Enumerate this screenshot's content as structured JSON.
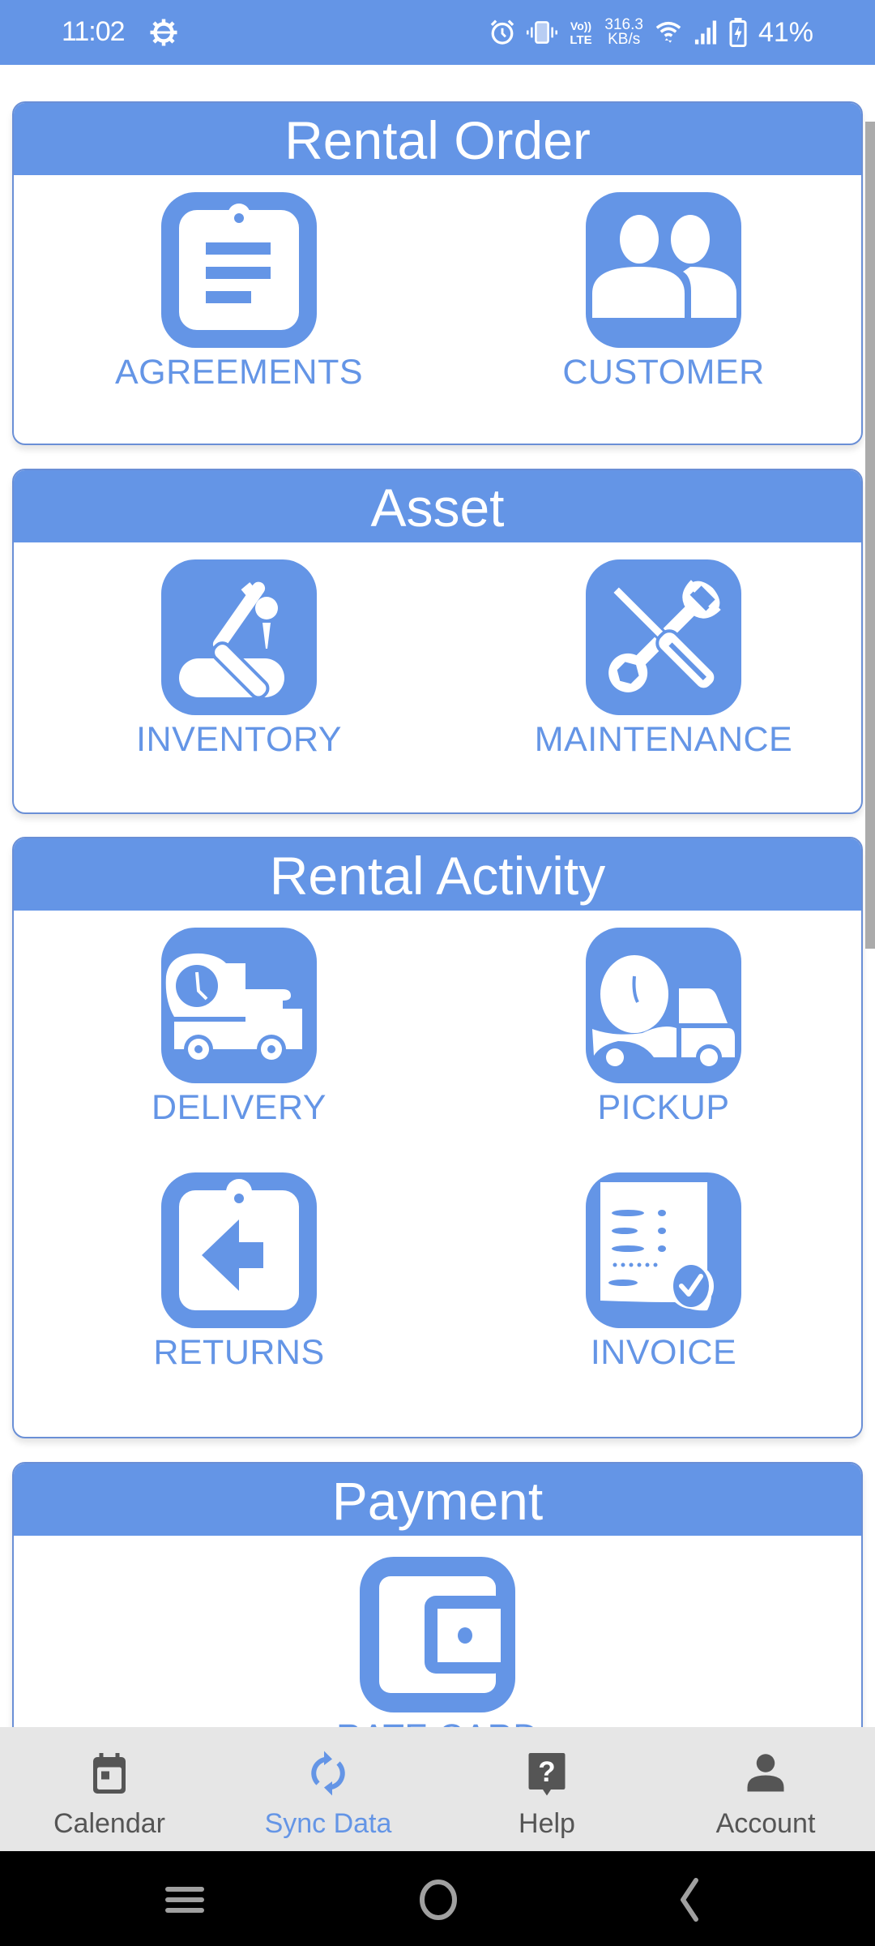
{
  "status_bar": {
    "time": "11:02",
    "net_speed_value": "316.3",
    "net_speed_unit": "KB/s",
    "volte_label_top": "Vo))",
    "volte_label_bottom": "LTE",
    "battery_percent": "41%",
    "icons": [
      "settings-gear-icon",
      "alarm-icon",
      "vibrate-icon",
      "volte-icon",
      "wifi-icon",
      "signal-icon",
      "battery-charging-icon"
    ]
  },
  "sections": [
    {
      "title": "Rental Order",
      "items": [
        {
          "label": "AGREEMENTS",
          "icon": "clipboard-list-icon"
        },
        {
          "label": "CUSTOMER",
          "icon": "people-icon"
        }
      ]
    },
    {
      "title": "Asset",
      "items": [
        {
          "label": "INVENTORY",
          "icon": "robot-arm-icon"
        },
        {
          "label": "MAINTENANCE",
          "icon": "wrench-screwdriver-icon"
        }
      ]
    },
    {
      "title": "Rental Activity",
      "items": [
        {
          "label": "DELIVERY",
          "icon": "delivery-truck-clock-icon"
        },
        {
          "label": "PICKUP",
          "icon": "pickup-truck-clock-icon"
        },
        {
          "label": "RETURNS",
          "icon": "clipboard-arrow-left-icon"
        },
        {
          "label": "INVOICE",
          "icon": "invoice-check-icon"
        }
      ]
    },
    {
      "title": "Payment",
      "items": [
        {
          "label": "RATE CARD",
          "icon": "wallet-icon"
        }
      ]
    }
  ],
  "bottom_nav": {
    "active": "Sync Data",
    "items": [
      {
        "label": "Calendar",
        "icon": "calendar-icon"
      },
      {
        "label": "Sync Data",
        "icon": "sync-icon"
      },
      {
        "label": "Help",
        "icon": "help-icon"
      },
      {
        "label": "Account",
        "icon": "account-icon"
      }
    ]
  },
  "system_nav": [
    "recents-icon",
    "home-icon",
    "back-icon"
  ],
  "colors": {
    "accent": "#6495E6",
    "nav_background": "#E6E6E6",
    "nav_inactive": "#555555"
  }
}
